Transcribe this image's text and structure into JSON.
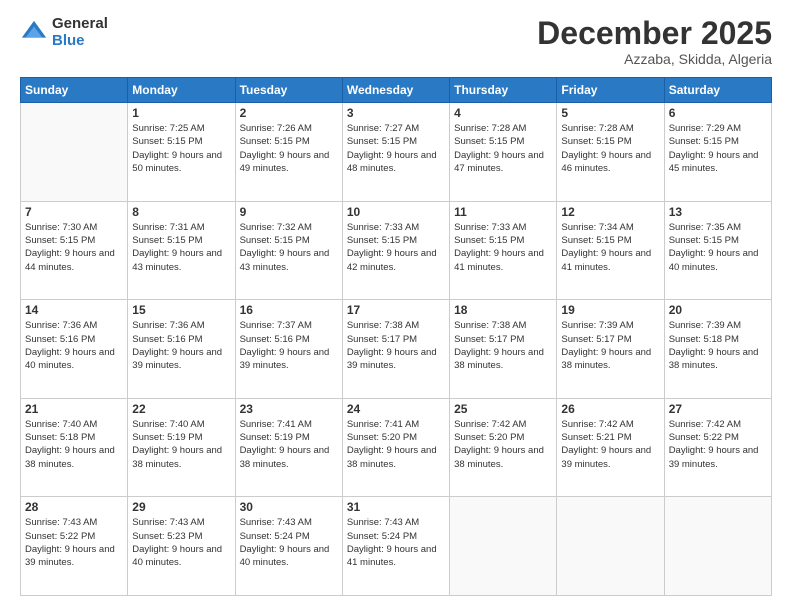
{
  "logo": {
    "general": "General",
    "blue": "Blue"
  },
  "title": "December 2025",
  "location": "Azzaba, Skidda, Algeria",
  "header_days": [
    "Sunday",
    "Monday",
    "Tuesday",
    "Wednesday",
    "Thursday",
    "Friday",
    "Saturday"
  ],
  "weeks": [
    [
      {
        "day": "",
        "sunrise": "",
        "sunset": "",
        "daylight": ""
      },
      {
        "day": "1",
        "sunrise": "Sunrise: 7:25 AM",
        "sunset": "Sunset: 5:15 PM",
        "daylight": "Daylight: 9 hours and 50 minutes."
      },
      {
        "day": "2",
        "sunrise": "Sunrise: 7:26 AM",
        "sunset": "Sunset: 5:15 PM",
        "daylight": "Daylight: 9 hours and 49 minutes."
      },
      {
        "day": "3",
        "sunrise": "Sunrise: 7:27 AM",
        "sunset": "Sunset: 5:15 PM",
        "daylight": "Daylight: 9 hours and 48 minutes."
      },
      {
        "day": "4",
        "sunrise": "Sunrise: 7:28 AM",
        "sunset": "Sunset: 5:15 PM",
        "daylight": "Daylight: 9 hours and 47 minutes."
      },
      {
        "day": "5",
        "sunrise": "Sunrise: 7:28 AM",
        "sunset": "Sunset: 5:15 PM",
        "daylight": "Daylight: 9 hours and 46 minutes."
      },
      {
        "day": "6",
        "sunrise": "Sunrise: 7:29 AM",
        "sunset": "Sunset: 5:15 PM",
        "daylight": "Daylight: 9 hours and 45 minutes."
      }
    ],
    [
      {
        "day": "7",
        "sunrise": "Sunrise: 7:30 AM",
        "sunset": "Sunset: 5:15 PM",
        "daylight": "Daylight: 9 hours and 44 minutes."
      },
      {
        "day": "8",
        "sunrise": "Sunrise: 7:31 AM",
        "sunset": "Sunset: 5:15 PM",
        "daylight": "Daylight: 9 hours and 43 minutes."
      },
      {
        "day": "9",
        "sunrise": "Sunrise: 7:32 AM",
        "sunset": "Sunset: 5:15 PM",
        "daylight": "Daylight: 9 hours and 43 minutes."
      },
      {
        "day": "10",
        "sunrise": "Sunrise: 7:33 AM",
        "sunset": "Sunset: 5:15 PM",
        "daylight": "Daylight: 9 hours and 42 minutes."
      },
      {
        "day": "11",
        "sunrise": "Sunrise: 7:33 AM",
        "sunset": "Sunset: 5:15 PM",
        "daylight": "Daylight: 9 hours and 41 minutes."
      },
      {
        "day": "12",
        "sunrise": "Sunrise: 7:34 AM",
        "sunset": "Sunset: 5:15 PM",
        "daylight": "Daylight: 9 hours and 41 minutes."
      },
      {
        "day": "13",
        "sunrise": "Sunrise: 7:35 AM",
        "sunset": "Sunset: 5:15 PM",
        "daylight": "Daylight: 9 hours and 40 minutes."
      }
    ],
    [
      {
        "day": "14",
        "sunrise": "Sunrise: 7:36 AM",
        "sunset": "Sunset: 5:16 PM",
        "daylight": "Daylight: 9 hours and 40 minutes."
      },
      {
        "day": "15",
        "sunrise": "Sunrise: 7:36 AM",
        "sunset": "Sunset: 5:16 PM",
        "daylight": "Daylight: 9 hours and 39 minutes."
      },
      {
        "day": "16",
        "sunrise": "Sunrise: 7:37 AM",
        "sunset": "Sunset: 5:16 PM",
        "daylight": "Daylight: 9 hours and 39 minutes."
      },
      {
        "day": "17",
        "sunrise": "Sunrise: 7:38 AM",
        "sunset": "Sunset: 5:17 PM",
        "daylight": "Daylight: 9 hours and 39 minutes."
      },
      {
        "day": "18",
        "sunrise": "Sunrise: 7:38 AM",
        "sunset": "Sunset: 5:17 PM",
        "daylight": "Daylight: 9 hours and 38 minutes."
      },
      {
        "day": "19",
        "sunrise": "Sunrise: 7:39 AM",
        "sunset": "Sunset: 5:17 PM",
        "daylight": "Daylight: 9 hours and 38 minutes."
      },
      {
        "day": "20",
        "sunrise": "Sunrise: 7:39 AM",
        "sunset": "Sunset: 5:18 PM",
        "daylight": "Daylight: 9 hours and 38 minutes."
      }
    ],
    [
      {
        "day": "21",
        "sunrise": "Sunrise: 7:40 AM",
        "sunset": "Sunset: 5:18 PM",
        "daylight": "Daylight: 9 hours and 38 minutes."
      },
      {
        "day": "22",
        "sunrise": "Sunrise: 7:40 AM",
        "sunset": "Sunset: 5:19 PM",
        "daylight": "Daylight: 9 hours and 38 minutes."
      },
      {
        "day": "23",
        "sunrise": "Sunrise: 7:41 AM",
        "sunset": "Sunset: 5:19 PM",
        "daylight": "Daylight: 9 hours and 38 minutes."
      },
      {
        "day": "24",
        "sunrise": "Sunrise: 7:41 AM",
        "sunset": "Sunset: 5:20 PM",
        "daylight": "Daylight: 9 hours and 38 minutes."
      },
      {
        "day": "25",
        "sunrise": "Sunrise: 7:42 AM",
        "sunset": "Sunset: 5:20 PM",
        "daylight": "Daylight: 9 hours and 38 minutes."
      },
      {
        "day": "26",
        "sunrise": "Sunrise: 7:42 AM",
        "sunset": "Sunset: 5:21 PM",
        "daylight": "Daylight: 9 hours and 39 minutes."
      },
      {
        "day": "27",
        "sunrise": "Sunrise: 7:42 AM",
        "sunset": "Sunset: 5:22 PM",
        "daylight": "Daylight: 9 hours and 39 minutes."
      }
    ],
    [
      {
        "day": "28",
        "sunrise": "Sunrise: 7:43 AM",
        "sunset": "Sunset: 5:22 PM",
        "daylight": "Daylight: 9 hours and 39 minutes."
      },
      {
        "day": "29",
        "sunrise": "Sunrise: 7:43 AM",
        "sunset": "Sunset: 5:23 PM",
        "daylight": "Daylight: 9 hours and 40 minutes."
      },
      {
        "day": "30",
        "sunrise": "Sunrise: 7:43 AM",
        "sunset": "Sunset: 5:24 PM",
        "daylight": "Daylight: 9 hours and 40 minutes."
      },
      {
        "day": "31",
        "sunrise": "Sunrise: 7:43 AM",
        "sunset": "Sunset: 5:24 PM",
        "daylight": "Daylight: 9 hours and 41 minutes."
      },
      {
        "day": "",
        "sunrise": "",
        "sunset": "",
        "daylight": ""
      },
      {
        "day": "",
        "sunrise": "",
        "sunset": "",
        "daylight": ""
      },
      {
        "day": "",
        "sunrise": "",
        "sunset": "",
        "daylight": ""
      }
    ]
  ]
}
